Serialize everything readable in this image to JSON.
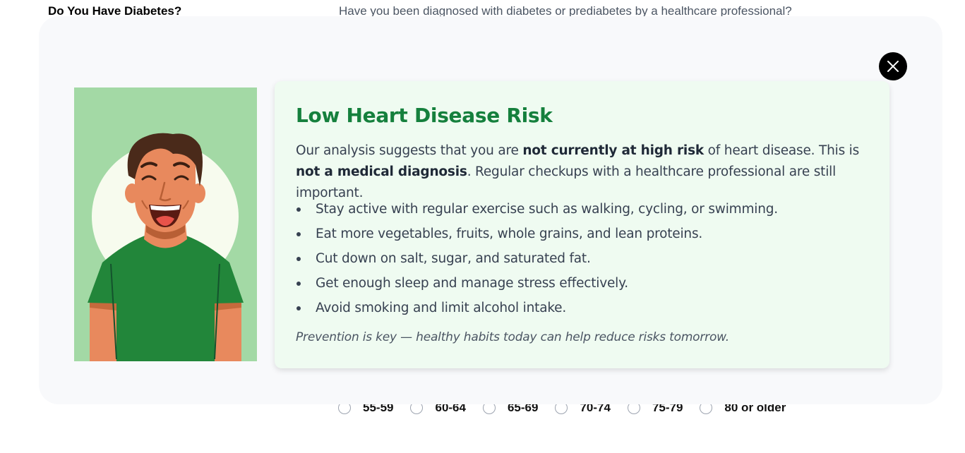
{
  "background": {
    "field_label": "Do You Have Diabetes?",
    "question": "Have you been diagnosed with diabetes or prediabetes by a healthcare professional?",
    "age_options": [
      "55-59",
      "60-64",
      "65-69",
      "70-74",
      "75-79",
      "80 or older"
    ]
  },
  "modal": {
    "close_icon": "close-icon",
    "illustration": "smiling-man-illustration",
    "title": "Low Heart Disease Risk",
    "intro": {
      "part1": "Our analysis suggests that you are ",
      "bold1": "not currently at high risk",
      "part2": " of heart disease. This is ",
      "bold2": "not a medical diagnosis",
      "part3": ". Regular checkups with a healthcare professional are still important."
    },
    "tips": [
      "Stay active with regular exercise such as walking, cycling, or swimming.",
      "Eat more vegetables, fruits, whole grains, and lean proteins.",
      "Cut down on salt, sugar, and saturated fat.",
      "Get enough sleep and manage stress effectively.",
      "Avoid smoking and limit alcohol intake."
    ],
    "footer": "Prevention is key — healthy habits today can help reduce risks tomorrow."
  },
  "colors": {
    "title": "#15803d",
    "card_bg": "#effbf1",
    "illustration_bg": "#a3d9a5",
    "shirt": "#22863a",
    "skin": "#e8895d"
  }
}
